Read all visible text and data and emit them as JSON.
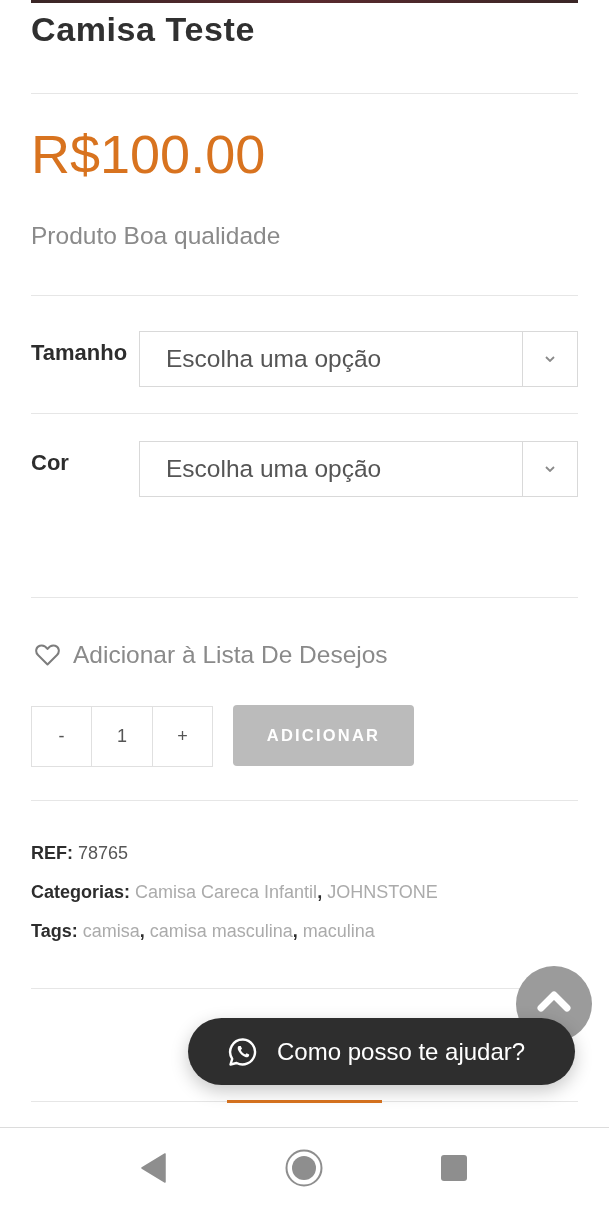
{
  "product": {
    "title": "Camisa Teste",
    "price": "R$100.00",
    "description": "Produto Boa qualidade"
  },
  "variations": [
    {
      "label": "Tamanho",
      "value": "Escolha uma opção"
    },
    {
      "label": "Cor",
      "value": "Escolha uma opção"
    }
  ],
  "wishlist": {
    "label": "Adicionar à Lista De Desejos"
  },
  "quantity": {
    "decrement": "-",
    "value": "1",
    "increment": "+"
  },
  "add_button": {
    "label": "ADICIONAR",
    "disabled": true
  },
  "meta": [
    {
      "kind": "text",
      "label": "REF:",
      "value": "78765"
    },
    {
      "kind": "links",
      "label": "Categorias:",
      "separator": ",",
      "links": [
        "Camisa Careca Infantil",
        "JOHNSTONE"
      ]
    },
    {
      "kind": "links",
      "label": "Tags:",
      "separator": ",",
      "links": [
        "camisa",
        "camisa masculina",
        "maculina"
      ]
    }
  ],
  "chat_button": {
    "label": "Como posso te ajudar?"
  }
}
